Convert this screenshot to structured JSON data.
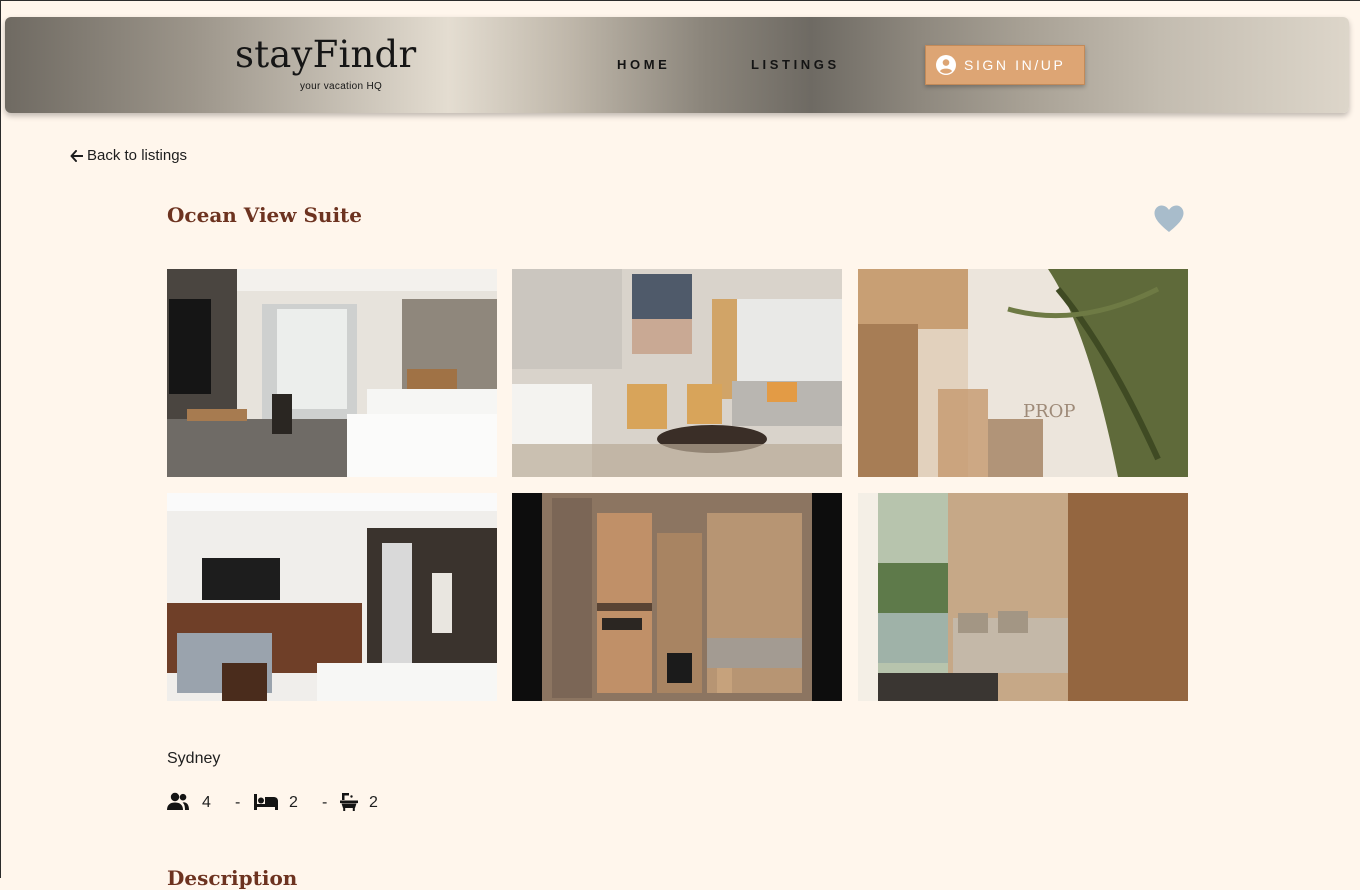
{
  "nav": {
    "brand": "stayFindr",
    "tagline": "your vacation HQ",
    "links": [
      "HOME",
      "LISTINGS"
    ],
    "signin_label": "SIGN IN/UP"
  },
  "back_label": "Back to listings",
  "listing": {
    "title": "Ocean View Suite",
    "favorite": false,
    "city": "Sydney",
    "guests": "4",
    "bedrooms": "2",
    "bathrooms": "2",
    "separator": "-",
    "section_heading": "Description"
  },
  "icons": {
    "back": "arrow-left-icon",
    "user": "user-circle-icon",
    "favorite": "heart-icon",
    "guests": "users-icon",
    "bedrooms": "bed-icon",
    "bathrooms": "bath-icon"
  },
  "colors": {
    "page_bg": "#fff6ec",
    "accent_button": "#dda574",
    "title": "#6d3320",
    "heart": "#a8bccb"
  }
}
